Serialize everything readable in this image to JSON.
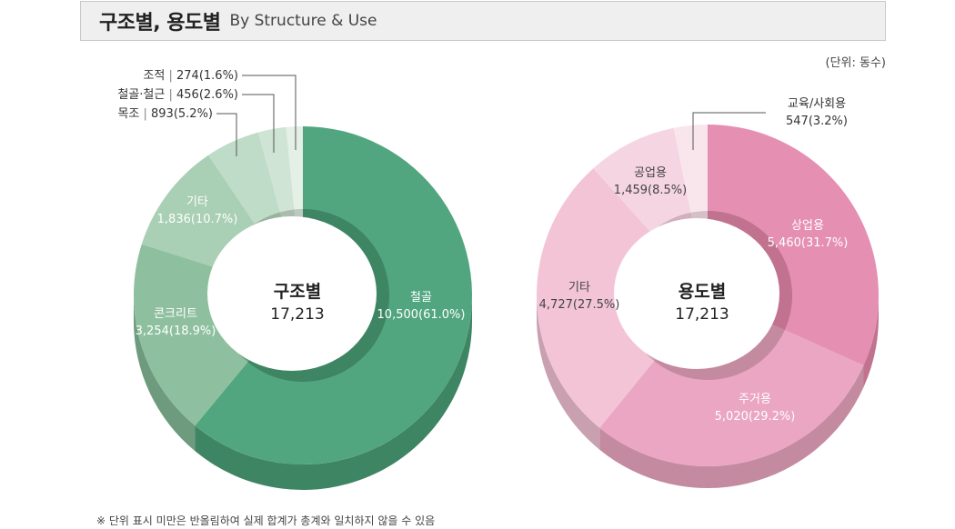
{
  "header": {
    "title_ko": "구조별, 용도별",
    "title_en": "By Structure & Use"
  },
  "unit_note": "(단위: 동수)",
  "footnote": "※ 단위 표시 미만은 반올림하여 실제 합계가 총계와 일치하지 않을 수 있음",
  "chart_data": [
    {
      "type": "pie",
      "center_label": "구조별",
      "total": "17,213",
      "slices": [
        {
          "name": "철골",
          "value": 10500,
          "value_label": "10,500(61.0%)",
          "color": "#52a67f",
          "side": "#3e8563"
        },
        {
          "name": "콘크리트",
          "value": 3254,
          "value_label": "3,254(18.9%)",
          "color": "#8ec09f",
          "side": "#6e9a7e"
        },
        {
          "name": "기타",
          "value": 1836,
          "value_label": "1,836(10.7%)",
          "color": "#a9cfb4",
          "side": "#86a691"
        },
        {
          "name": "목조",
          "value": 893,
          "value_label": "893(5.2%)",
          "color": "#bfdcc8",
          "side": "#9ab39f"
        },
        {
          "name": "철골·철근",
          "value": 456,
          "value_label": "456(2.6%)",
          "color": "#cfe4d5",
          "side": "#a9bdae"
        },
        {
          "name": "조적",
          "value": 274,
          "value_label": "274(1.6%)",
          "color": "#e4efe6",
          "side": "#bcc9be"
        }
      ]
    },
    {
      "type": "pie",
      "center_label": "용도별",
      "total": "17,213",
      "slices": [
        {
          "name": "상업용",
          "value": 5460,
          "value_label": "5,460(31.7%)",
          "color": "#e58fb2",
          "side": "#c0728f"
        },
        {
          "name": "주거용",
          "value": 5020,
          "value_label": "5,020(29.2%)",
          "color": "#eaa6c3",
          "side": "#c48aa0"
        },
        {
          "name": "기타",
          "value": 4727,
          "value_label": "4,727(27.5%)",
          "color": "#f3c4d6",
          "side": "#c9a0b0"
        },
        {
          "name": "공업용",
          "value": 1459,
          "value_label": "1,459(8.5%)",
          "color": "#f5d5e1",
          "side": "#d0b0bc"
        },
        {
          "name": "교육/사회용",
          "value": 547,
          "value_label": "547(3.2%)",
          "color": "#f9e6ed",
          "side": "#d6c0c8"
        }
      ]
    }
  ]
}
